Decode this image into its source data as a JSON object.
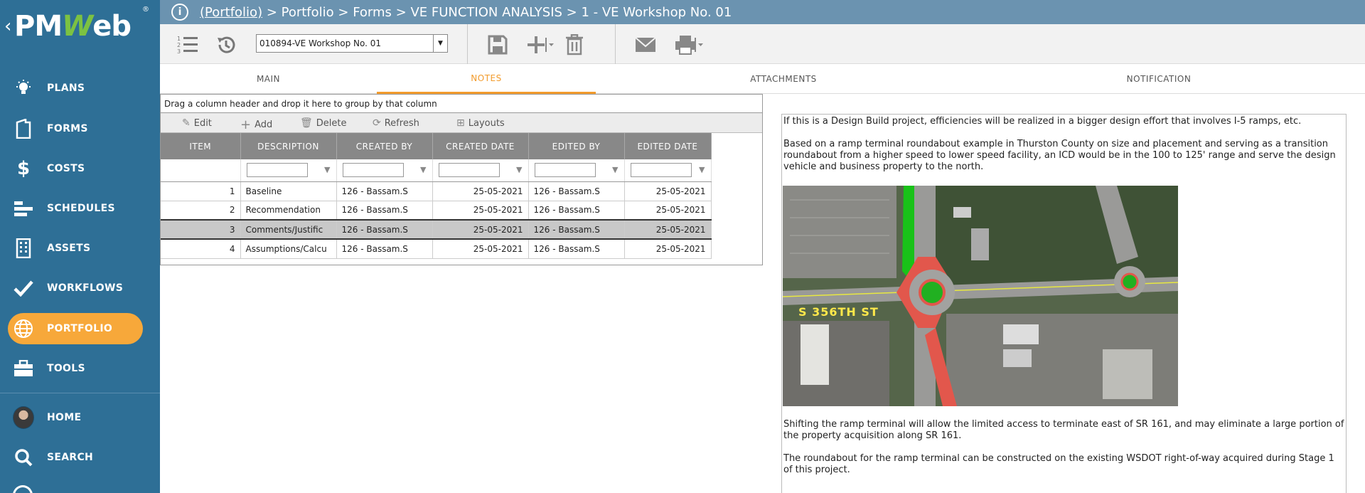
{
  "app": {
    "logo_pm": "PM",
    "logo_w": "W",
    "logo_eb": "eb",
    "logo_reg": "®",
    "back": "‹"
  },
  "sidebar": {
    "items": [
      {
        "label": "PLANS",
        "icon": "lightbulb-icon"
      },
      {
        "label": "FORMS",
        "icon": "document-icon"
      },
      {
        "label": "COSTS",
        "icon": "dollar-icon"
      },
      {
        "label": "SCHEDULES",
        "icon": "gantt-icon"
      },
      {
        "label": "ASSETS",
        "icon": "building-icon"
      },
      {
        "label": "WORKFLOWS",
        "icon": "checkmark-icon"
      },
      {
        "label": "PORTFOLIO",
        "icon": "globe-icon",
        "active": true
      },
      {
        "label": "TOOLS",
        "icon": "briefcase-icon"
      },
      {
        "label": "HOME",
        "icon": "avatar"
      },
      {
        "label": "SEARCH",
        "icon": "search-icon"
      }
    ]
  },
  "breadcrumb": {
    "link": "(Portfolio)",
    "rest": " > Portfolio > Forms > VE FUNCTION ANALYSIS > 1 - VE Workshop No. 01"
  },
  "toolbar": {
    "record_value": "010894-VE Workshop No. 01"
  },
  "tabs": [
    {
      "label": "MAIN"
    },
    {
      "label": "NOTES",
      "active": true
    },
    {
      "label": "ATTACHMENTS"
    },
    {
      "label": "NOTIFICATION"
    }
  ],
  "grid": {
    "group_hint": "Drag a column header and drop it here to group by that column",
    "tools": {
      "edit": "Edit",
      "add": "Add",
      "delete": "Delete",
      "refresh": "Refresh",
      "layouts": "Layouts"
    },
    "columns": [
      "ITEM",
      "DESCRIPTION",
      "CREATED BY",
      "CREATED DATE",
      "EDITED BY",
      "EDITED DATE"
    ],
    "rows": [
      {
        "item": "1",
        "description": "Baseline",
        "created_by": "126 - Bassam.S",
        "created_date": "25-05-2021",
        "edited_by": "126 - Bassam.S",
        "edited_date": "25-05-2021"
      },
      {
        "item": "2",
        "description": "Recommendation",
        "created_by": "126 - Bassam.S",
        "created_date": "25-05-2021",
        "edited_by": "126 - Bassam.S",
        "edited_date": "25-05-2021"
      },
      {
        "item": "3",
        "description": "Comments/Justific",
        "created_by": "126 - Bassam.S",
        "created_date": "25-05-2021",
        "edited_by": "126 - Bassam.S",
        "edited_date": "25-05-2021",
        "selected": true
      },
      {
        "item": "4",
        "description": "Assumptions/Calcu",
        "created_by": "126 - Bassam.S",
        "created_date": "25-05-2021",
        "edited_by": "126 - Bassam.S",
        "edited_date": "25-05-2021"
      }
    ]
  },
  "notes": {
    "p1": "If this is a Design Build project, efficiencies will be realized in a bigger design effort that involves I-5 ramps, etc.",
    "p2": "Based on a ramp terminal roundabout example in Thurston County on size and placement and serving as a transition roundabout from a higher speed to lower speed facility, an ICD would be in the 100 to 125' range and serve the design vehicle and business property to the north.",
    "map_label": "S 356TH ST",
    "p3": "Shifting the ramp terminal will allow the limited access to terminate east of SR 161, and may eliminate a large portion of the property acquisition along SR 161.",
    "p4": "The roundabout for the ramp terminal can be constructed on the existing WSDOT right-of-way acquired during Stage 1 of this project."
  },
  "colors": {
    "sidebar": "#2e6f96",
    "active": "#f7a83a",
    "topbar": "#6b93b0",
    "tab_active": "#f29b2c"
  }
}
